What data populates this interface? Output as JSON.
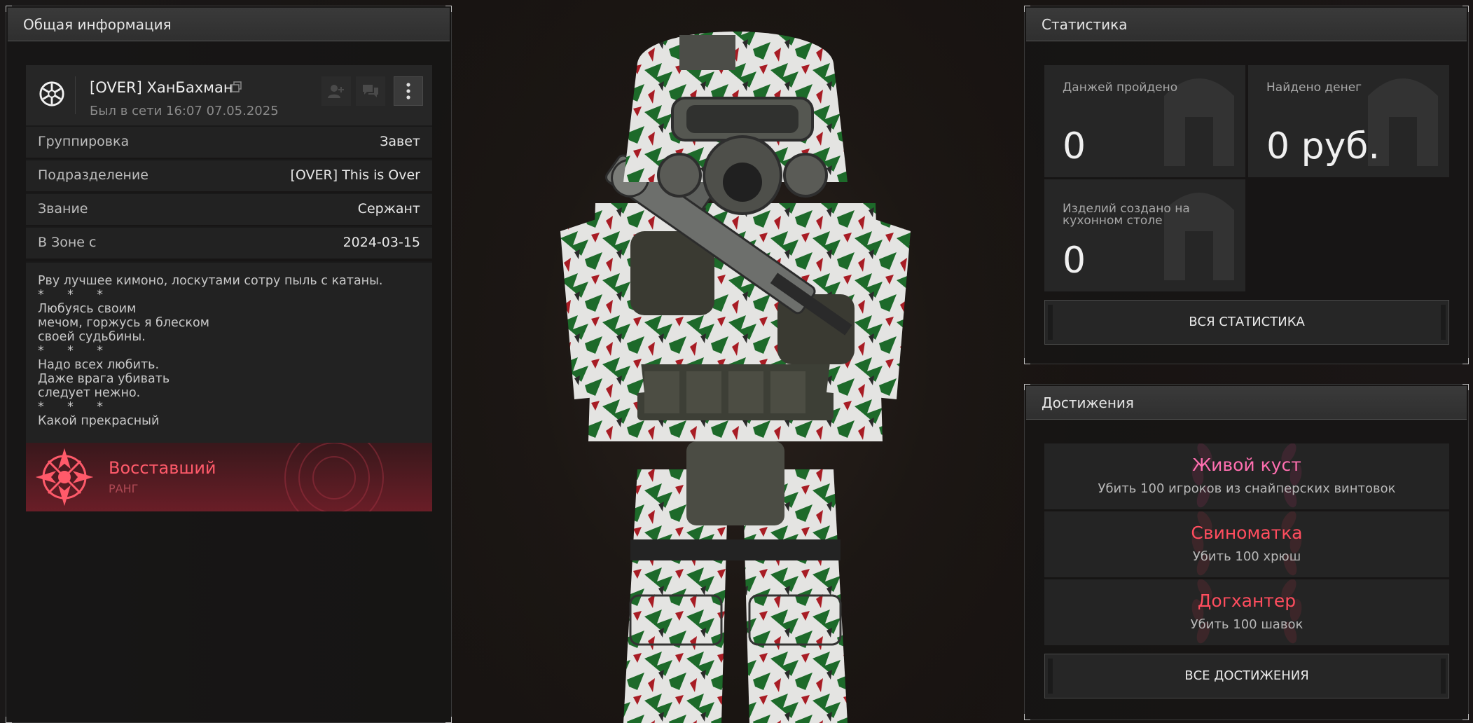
{
  "left": {
    "header": "Общая информация",
    "profile": {
      "name": "[OVER] ХанБахман",
      "last_online": "Был в сети 16:07 07.05.2025"
    },
    "rows": [
      {
        "label": "Группировка",
        "value": "Завет"
      },
      {
        "label": "Подразделение",
        "value": "[OVER] This is Over"
      },
      {
        "label": "Звание",
        "value": "Сержант"
      },
      {
        "label": "В Зоне с",
        "value": "2024-03-15"
      }
    ],
    "bio": "Рву лучшее кимоно, лоскутами сотру пыль с катаны.\n*      *      *\nЛюбуясь своим\nмечом, горжусь я блеском\nсвоей судьбины.\n*      *      *\nНадо всех любить.\nДаже врага убивать\nследует нежно.\n*      *      *\nКакой прекрасный",
    "rank": {
      "name": "Восставший",
      "sub": "РАНГ",
      "color": "#ff5a6a"
    }
  },
  "stats": {
    "header": "Статистика",
    "items": [
      {
        "label": "Данжей пройдено",
        "value": "0"
      },
      {
        "label": "Найдено денег",
        "value": "0 руб."
      },
      {
        "label": "Изделий создано на кухонном столе",
        "value": "0"
      }
    ],
    "button": "ВСЯ СТАТИСТИКА"
  },
  "achievements": {
    "header": "Достижения",
    "items": [
      {
        "title": "Живой куст",
        "desc": "Убить 100 игроков из снайперских винтовок",
        "color": "#ff6fb0"
      },
      {
        "title": "Свиноматка",
        "desc": "Убить 100 хрюш",
        "color": "#ff4d5e"
      },
      {
        "title": "Догхантер",
        "desc": "Убить 100 шавок",
        "color": "#ff4d5e"
      }
    ],
    "button": "ВСЕ ДОСТИЖЕНИЯ"
  },
  "icons": [
    "faction-emblem-icon",
    "copy-icon",
    "add-friend-icon",
    "chat-icon",
    "more-vertical-icon",
    "rank-emblem-icon",
    "laurel-icon"
  ]
}
